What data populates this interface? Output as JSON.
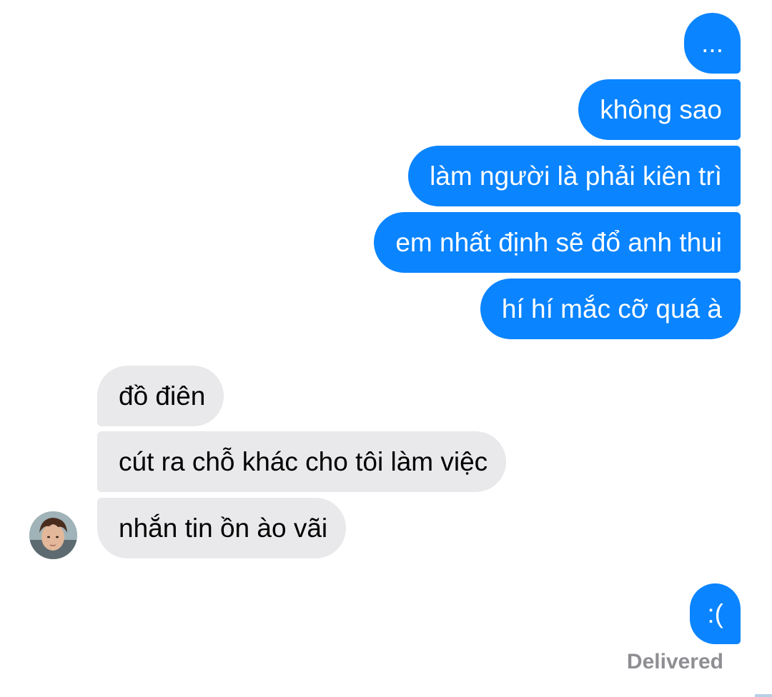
{
  "messages": {
    "outgoing_group_1": [
      "...",
      "không sao",
      "làm người là phải kiên trì",
      "em nhất định sẽ đổ anh thui",
      "hí hí mắc cỡ quá à"
    ],
    "incoming_group": [
      "đồ điên",
      "cút ra chỗ khác cho tôi làm việc",
      "nhắn tin ồn ào vãi"
    ],
    "outgoing_group_2": [
      ":("
    ]
  },
  "status": {
    "delivered": "Delivered"
  },
  "colors": {
    "outgoing_bubble": "#0a84ff",
    "incoming_bubble": "#e9e9eb",
    "status_text": "#8e8e93"
  }
}
